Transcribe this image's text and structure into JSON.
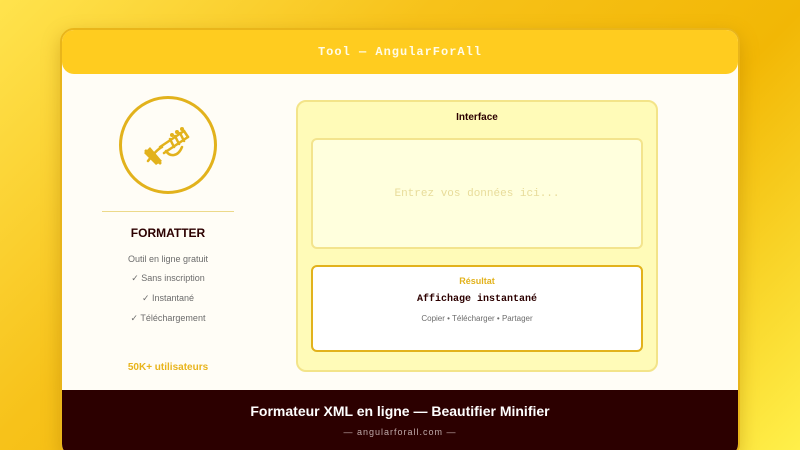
{
  "window": {
    "title": "Tool — AngularForAll"
  },
  "sidebar": {
    "icon": "trumpet-icon",
    "title": "FORMATTER",
    "subtitle": "Outil en ligne gratuit",
    "features": [
      "✓ Sans inscription",
      "✓ Instantané",
      "✓ Téléchargement"
    ],
    "users": "50K+ utilisateurs"
  },
  "interface": {
    "title": "Interface",
    "input_placeholder": "Entrez vos données ici...",
    "result_label": "Résultat",
    "result_value": "Affichage instantané",
    "result_actions": "Copier • Télécharger • Partager"
  },
  "footer": {
    "title": "Formateur XML en ligne — Beautifier Minifier",
    "url": "— angularforall.com —"
  },
  "colors": {
    "accent": "#e2b21c",
    "titlebar": "#ffcc1f",
    "footer": "#2c0000",
    "panel": "#fffbb8"
  }
}
